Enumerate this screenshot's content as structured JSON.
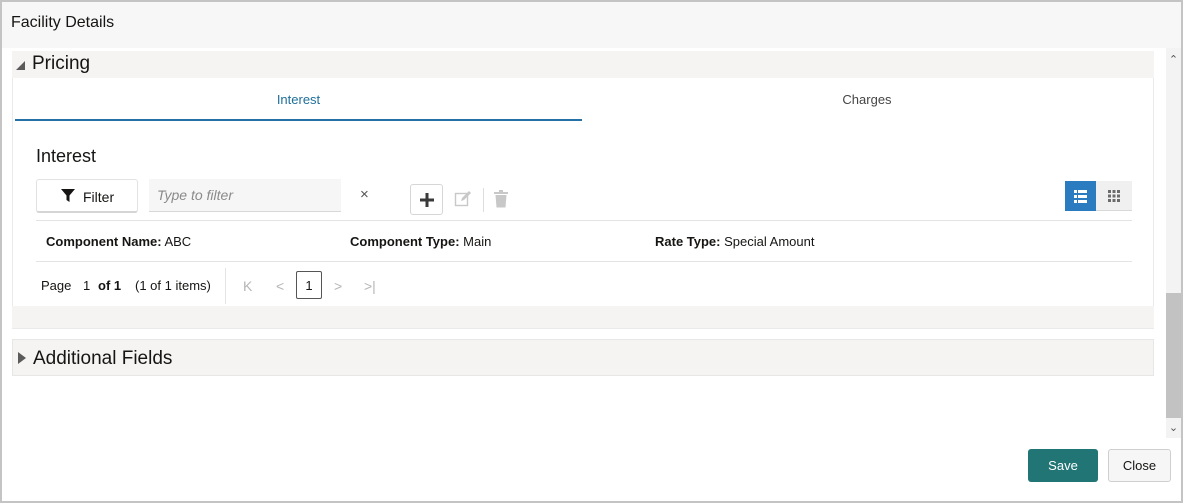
{
  "dialog": {
    "title": "Facility Details"
  },
  "pricing": {
    "title": "Pricing",
    "tabs": [
      {
        "label": "Interest",
        "active": true
      },
      {
        "label": "Charges",
        "active": false
      }
    ],
    "interest": {
      "title": "Interest",
      "filter": {
        "button_label": "Filter",
        "placeholder": "Type to filter",
        "clear_glyph": "×"
      },
      "toolbar": {
        "add_icon": "plus-icon",
        "edit_icon": "edit-icon",
        "delete_icon": "trash-icon"
      },
      "view_toggle": {
        "list_icon": "list-view-icon",
        "grid_icon": "grid-view-icon",
        "active": "list"
      },
      "rows": [
        [
          {
            "label": "Component Name:",
            "value": "ABC"
          },
          {
            "label": "Component Type:",
            "value": "Main"
          },
          {
            "label": "Rate Type:",
            "value": "Special Amount"
          }
        ]
      ],
      "pager": {
        "page_label": "Page",
        "page_input": "1",
        "of_label": "of 1",
        "items_label": "(1 of 1 items)",
        "current_page": "1",
        "first_glyph": "K",
        "prev_glyph": "<",
        "next_glyph": ">",
        "last_glyph": ">|"
      }
    }
  },
  "additional_fields": {
    "title": "Additional Fields"
  },
  "footer": {
    "save_label": "Save",
    "close_label": "Close"
  },
  "colors": {
    "accent": "#227575",
    "tab_active": "#2670a8",
    "list_view_active": "#2b7bc0"
  }
}
